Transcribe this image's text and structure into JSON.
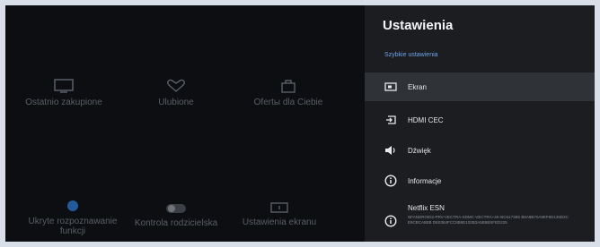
{
  "background": {
    "tiles_row1": [
      {
        "label": "Ostatnio zakupione",
        "icon": "tv-icon"
      },
      {
        "label": "Ulubione",
        "icon": "heart-icon"
      },
      {
        "label": "Ofertы dla Ciebie",
        "icon": "bag-icon"
      }
    ],
    "tiles_row2": [
      {
        "label": "Ukryte rozpoznawanie funkcji",
        "icon": "status-dot-icon"
      },
      {
        "label": "Kontrola rodzicielska",
        "icon": "toggle-icon"
      },
      {
        "label": "Ustawienia ekranu",
        "icon": "monitor-icon"
      }
    ]
  },
  "panel": {
    "title": "Ustawienia",
    "section_label": "Szybkie ustawienia",
    "items": [
      {
        "label": "Ekran",
        "icon": "screen-icon",
        "selected": true
      },
      {
        "label": "HDMI CEC",
        "icon": "input-icon"
      },
      {
        "label": "Dźwięk",
        "icon": "speaker-icon"
      },
      {
        "label": "Informacje",
        "icon": "info-icon"
      }
    ],
    "netflix": {
      "label": "Netflix ESN",
      "value": "NFANDROID2-PRV-VECTRA-SDMC-VECTRA+4K-BC61738S B6A8B70A9EF6D135D2CE9CBCA8EB D8S384FCC8B9E102B3A5B5BSFED225",
      "icon": "info-icon"
    }
  },
  "colors": {
    "panel_bg": "#1b1d21",
    "selected_bg": "#2f3237",
    "accent": "#6fa3e8"
  }
}
